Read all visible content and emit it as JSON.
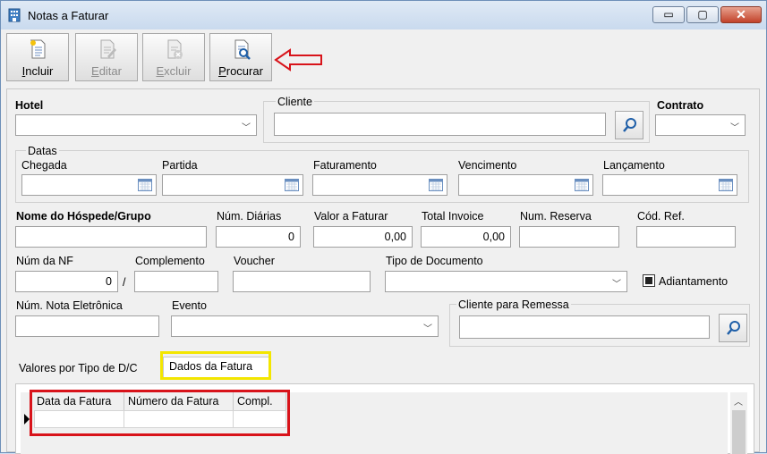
{
  "window": {
    "title": "Notas a Faturar"
  },
  "window_controls": {
    "minimize": "▭",
    "maximize": "▢",
    "close": "✕"
  },
  "toolbar": [
    {
      "label": "Incluir",
      "icon": "new-document-icon",
      "enabled": true
    },
    {
      "label": "Editar",
      "icon": "edit-document-icon",
      "enabled": false
    },
    {
      "label": "Excluir",
      "icon": "delete-document-icon",
      "enabled": false
    },
    {
      "label": "Procurar",
      "icon": "search-document-icon",
      "enabled": true
    }
  ],
  "form": {
    "hotel": {
      "label": "Hotel",
      "value": ""
    },
    "cliente": {
      "label": "Cliente",
      "value": ""
    },
    "contrato": {
      "label": "Contrato",
      "value": ""
    },
    "datas": {
      "group_label": "Datas",
      "fields": [
        {
          "label": "Chegada",
          "value": ""
        },
        {
          "label": "Partida",
          "value": ""
        },
        {
          "label": "Faturamento",
          "value": ""
        },
        {
          "label": "Vencimento",
          "value": ""
        },
        {
          "label": "Lançamento",
          "value": ""
        }
      ]
    },
    "nome_hospede": {
      "label": "Nome do Hóspede/Grupo",
      "value": ""
    },
    "num_diarias": {
      "label": "Núm. Diárias",
      "value": "0"
    },
    "valor_faturar": {
      "label": "Valor a Faturar",
      "value": "0,00"
    },
    "total_invoice": {
      "label": "Total Invoice",
      "value": "0,00"
    },
    "num_reserva": {
      "label": "Num. Reserva",
      "value": ""
    },
    "cod_ref": {
      "label": "Cód. Ref.",
      "value": ""
    },
    "num_nf": {
      "label": "Núm da NF",
      "value": "0"
    },
    "separator": "/",
    "complemento": {
      "label": "Complemento",
      "value": ""
    },
    "voucher": {
      "label": "Voucher",
      "value": ""
    },
    "tipo_documento": {
      "label": "Tipo de Documento",
      "value": ""
    },
    "adiantamento": {
      "label": "Adiantamento",
      "checked": true
    },
    "num_nota_eletronica": {
      "label": "Núm. Nota Eletrônica",
      "value": ""
    },
    "evento": {
      "label": "Evento",
      "value": ""
    },
    "cliente_remessa": {
      "label": "Cliente para Remessa",
      "value": ""
    }
  },
  "tabs": [
    {
      "label": "Valores por Tipo de D/C",
      "active": false
    },
    {
      "label": "Dados da Fatura",
      "active": true
    }
  ],
  "grid": {
    "columns": [
      "Data da Fatura",
      "Número da Fatura",
      "Compl."
    ],
    "rows": [
      [
        "",
        "",
        ""
      ]
    ]
  },
  "colors": {
    "highlight_yellow": "#f3e600",
    "highlight_red": "#d8131a",
    "accent_blue": "#1f5fa8"
  }
}
